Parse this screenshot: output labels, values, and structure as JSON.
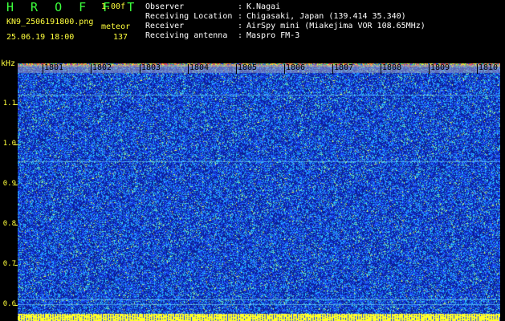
{
  "header": {
    "brand": "H R O F F T",
    "version": "1.00f",
    "filename": "KN9_2506191800.png",
    "mode": "meteor",
    "datetime": "25.06.19 18:00",
    "count": "137"
  },
  "info": [
    {
      "label": "Observer",
      "value": "K.Nagai"
    },
    {
      "label": "Receiving Location",
      "value": "Chigasaki, Japan (139.414 35.340)"
    },
    {
      "label": "Receiver",
      "value": "AirSpy mini (Miakejima VOR 108.65MHz)"
    },
    {
      "label": "Receiving antenna",
      "value": "Maspro FM-3"
    }
  ],
  "spectrogram": {
    "y_unit": "kHz",
    "y_ticks": [
      "1.1",
      "1.0",
      "0.9",
      "0.8",
      "0.7",
      "0.6"
    ],
    "x_ticks": [
      "1801",
      "1802",
      "1803",
      "1804",
      "1805",
      "1806",
      "1807",
      "1808",
      "1809",
      "1810"
    ],
    "colors": {
      "background": "#0a1e9a",
      "noise_low": "#1f4fff",
      "noise_mid": "#24c8ff",
      "noise_high": "#ffff00",
      "label": "#ffff3c",
      "text": "#3cff3c"
    }
  }
}
